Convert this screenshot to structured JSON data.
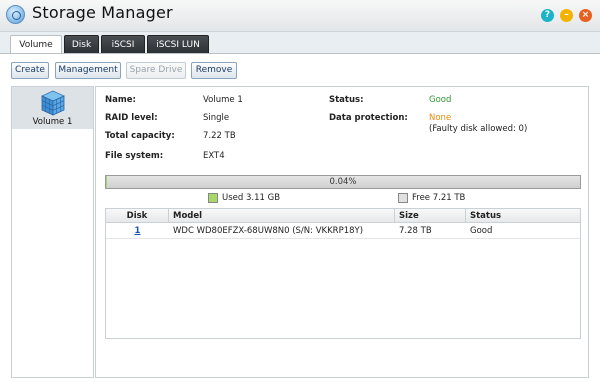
{
  "window": {
    "title": "Storage Manager",
    "help_label": "?",
    "minimize_label": "–",
    "close_label": "×"
  },
  "tabs": [
    {
      "label": "Volume",
      "active": true
    },
    {
      "label": "Disk",
      "active": false
    },
    {
      "label": "iSCSI",
      "active": false
    },
    {
      "label": "iSCSI LUN",
      "active": false
    }
  ],
  "toolbar": {
    "create": "Create",
    "management": "Management",
    "spare_drive": "Spare Drive",
    "remove": "Remove"
  },
  "volume_list": [
    {
      "label": "Volume 1",
      "selected": true
    }
  ],
  "details": {
    "name_label": "Name:",
    "name_value": "Volume 1",
    "raid_label": "RAID level:",
    "raid_value": "Single",
    "capacity_label": "Total capacity:",
    "capacity_value": "7.22 TB",
    "fs_label": "File system:",
    "fs_value": "EXT4",
    "status_label": "Status:",
    "status_value": "Good",
    "protection_label": "Data protection:",
    "protection_value": "None",
    "protection_note": "(Faulty disk allowed: 0)"
  },
  "usage": {
    "percent_text": "0.04%",
    "fraction": 0.0004,
    "used_label": "Used 3.11 GB",
    "free_label": "Free 7.21 TB",
    "used_color": "#a6d96a",
    "free_color": "#e0e0e0"
  },
  "table": {
    "headers": [
      "Disk",
      "Model",
      "Size",
      "Status"
    ],
    "rows": [
      {
        "disk": "1",
        "model": "WDC WD80EFZX-68UW8N0 (S/N: VKKRP18Y)",
        "size": "7.28 TB",
        "status": "Good"
      }
    ]
  },
  "colors": {
    "good": "#2f9a2f",
    "none": "#e88a10",
    "help": "#1bb3c8",
    "minimize": "#f2b300",
    "close": "#e8601f"
  }
}
